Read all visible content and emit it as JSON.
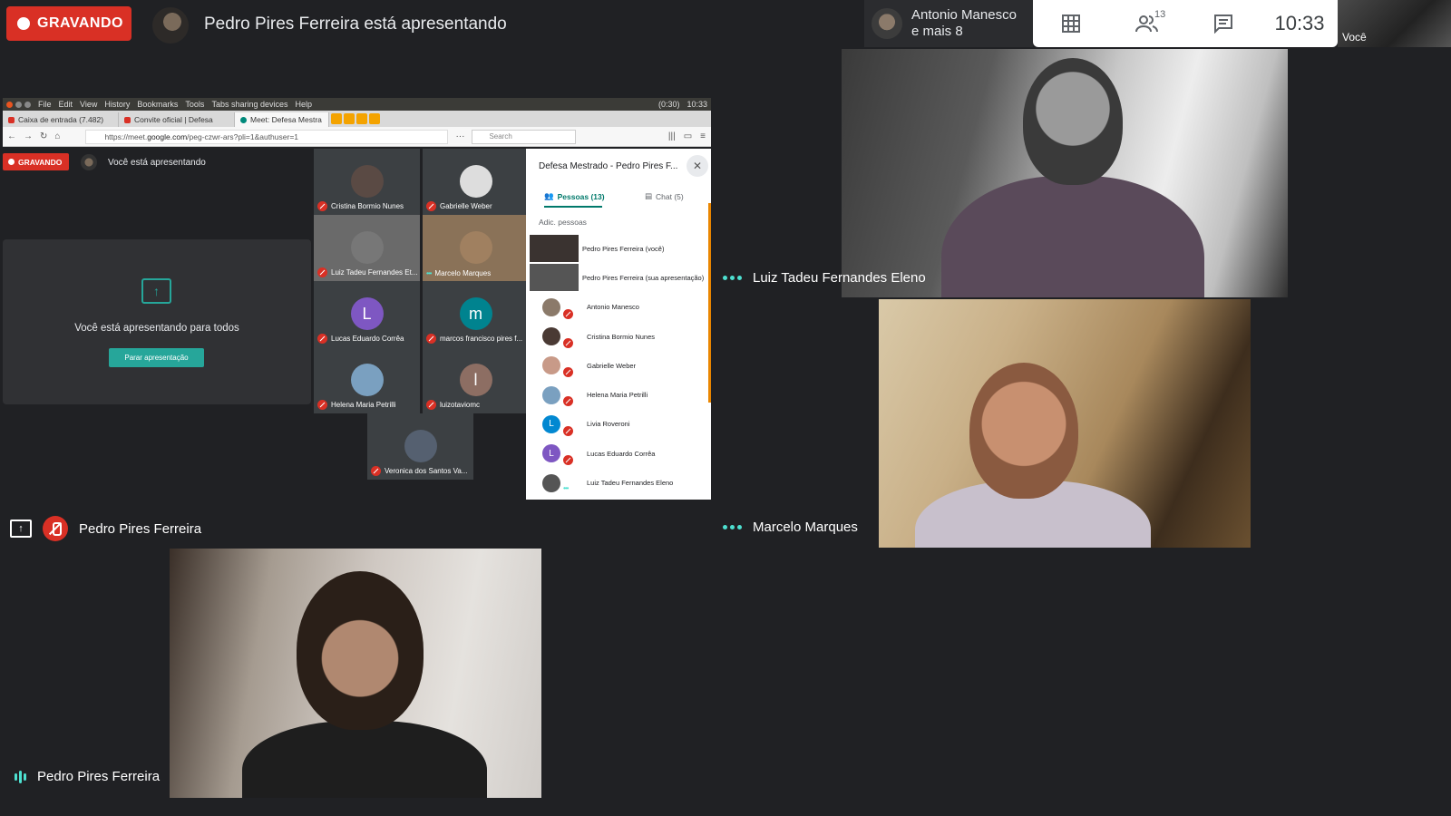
{
  "top": {
    "recording_label": "GRAVANDO",
    "presenter_text": "Pedro Pires Ferreira está apresentando",
    "participants_chip": {
      "line1": "Antonio Manesco",
      "line2": "e mais 8"
    },
    "people_count": "13",
    "clock": "10:33",
    "self_label": "Você"
  },
  "shared": {
    "os_menu": [
      "File",
      "Edit",
      "View",
      "History",
      "Bookmarks",
      "Tools",
      "Tabs sharing devices",
      "Help"
    ],
    "os_status": {
      "battery": "(0:30)",
      "time": "10:33"
    },
    "tabs": [
      {
        "label": "Caixa de entrada (7.482)"
      },
      {
        "label": "Convite oficial | Defesa"
      },
      {
        "label": "Meet: Defesa Mestra"
      }
    ],
    "url_prefix": "https://meet.",
    "url_domain": "google.com",
    "url_rest": "/peg-czwr-ars?pli=1&authuser=1",
    "search_placeholder": "Search",
    "inner_recording_label": "GRAVANDO",
    "inner_presenter_text": "Você está apresentando",
    "present_card_text": "Você está apresentando para todos",
    "stop_button": "Parar apresentação",
    "tiles": [
      {
        "name": "Cristina Bormio Nunes",
        "initial": "",
        "color": "#5a4a44"
      },
      {
        "name": "Gabrielle Weber",
        "initial": "",
        "color": "#ddd"
      },
      {
        "name": "Luiz Tadeu Fernandes Et...",
        "initial": "",
        "color": "#777"
      },
      {
        "name": "Marcelo Marques",
        "initial": "",
        "color": "#a08060"
      },
      {
        "name": "Lucas Eduardo Corrêa",
        "initial": "L",
        "color": "#7e57c2"
      },
      {
        "name": "marcos francisco pires f...",
        "initial": "m",
        "color": "#00838f"
      },
      {
        "name": "Helena Maria Petrilli",
        "initial": "",
        "color": "#7aa0c0"
      },
      {
        "name": "luizotaviomc",
        "initial": "l",
        "color": "#8d6e63"
      },
      {
        "name": "Veronica dos Santos Va...",
        "initial": "",
        "color": "#556070"
      }
    ],
    "panel": {
      "title": "Defesa Mestrado - Pedro Pires F...",
      "tab_people": "Pessoas (13)",
      "tab_chat": "Chat (5)",
      "add_people": "Adic. pessoas",
      "people": [
        {
          "name": "Pedro Pires Ferreira (você)",
          "initial": "",
          "color": "#3a3330"
        },
        {
          "name": "Pedro Pires Ferreira (sua apresentação)",
          "initial": "",
          "color": "#555"
        },
        {
          "name": "Antonio Manesco",
          "initial": "",
          "color": "#8b7a6a"
        },
        {
          "name": "Cristina Bormio Nunes",
          "initial": "",
          "color": "#4a3a34"
        },
        {
          "name": "Gabrielle Weber",
          "initial": "",
          "color": "#c89a88"
        },
        {
          "name": "Helena Maria Petrilli",
          "initial": "",
          "color": "#7aa0c0"
        },
        {
          "name": "Livia Roveroni",
          "initial": "L",
          "color": "#0288d1"
        },
        {
          "name": "Lucas Eduardo Corrêa",
          "initial": "L",
          "color": "#7e57c2"
        },
        {
          "name": "Luiz Tadeu Fernandes Eleno",
          "initial": "",
          "color": "#555"
        }
      ]
    }
  },
  "tiles": {
    "presentation_label": "Pedro Pires Ferreira",
    "luiz_label": "Luiz Tadeu Fernandes Eleno",
    "marcelo_label": "Marcelo Marques",
    "pedro_label": "Pedro Pires Ferreira"
  },
  "colors": {
    "recording": "#d93025",
    "accent": "#26a69a",
    "background": "#202124"
  }
}
